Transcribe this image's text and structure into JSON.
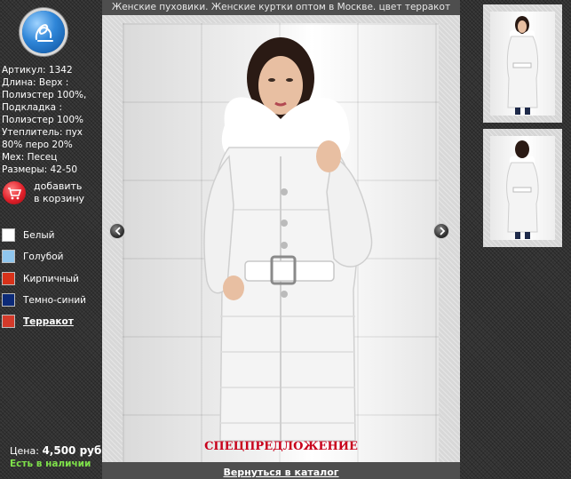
{
  "title": "Женские пуховики. Женские куртки оптом в Москве. цвет терракот",
  "specs": [
    "Артикул: 1342",
    "Длина: Верх :",
    "Полиэстер 100%,",
    "Подкладка :",
    "Полиэстер 100%",
    "Утеплитель: пух",
    "80% перо 20%",
    "Мех: Песец",
    "Размеры: 42-50"
  ],
  "cart": {
    "label_line1": "добавить",
    "label_line2": "в корзину",
    "icon": "cart-icon"
  },
  "colors": [
    {
      "label": "Белый",
      "swatch": "#ffffff",
      "active": false
    },
    {
      "label": "Голубой",
      "swatch": "#8fc6ee",
      "active": false
    },
    {
      "label": "Кирпичный",
      "swatch": "#d8321a",
      "active": false
    },
    {
      "label": "Темно-синий",
      "swatch": "#0c2a78",
      "active": false
    },
    {
      "label": "Терракот",
      "swatch": "#d43a2a",
      "active": true
    }
  ],
  "price": {
    "label": "Цена:",
    "value": "4,500 руб."
  },
  "stock": "Есть в наличии",
  "special": "СПЕЦПРЕДЛОЖЕНИЕ",
  "back_link": "Вернуться в каталог",
  "icons": {
    "logo": "logo-icon",
    "prev": "arrow-left-icon",
    "next": "arrow-right-icon"
  }
}
